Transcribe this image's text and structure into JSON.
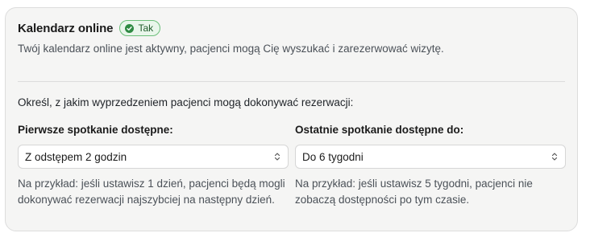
{
  "header": {
    "title": "Kalendarz online",
    "badge": "Tak",
    "description": "Twój kalendarz online jest aktywny, pacjenci mogą Cię wyszukać i zarezerwować wizytę."
  },
  "booking": {
    "intro": "Określ, z jakim wyprzedzeniem pacjenci mogą dokonywać rezerwacji:",
    "first": {
      "label": "Pierwsze spotkanie dostępne:",
      "value": "Z odstępem 2 godzin",
      "help": "Na przykład: jeśli ustawisz 1 dzień, pacjenci będą mogli dokonywać rezerwacji najszybciej na następny dzień."
    },
    "last": {
      "label": "Ostatnie spotkanie dostępne do:",
      "value": "Do 6 tygodni",
      "help": "Na przykład: jeśli ustawisz 5 tygodni, pacjenci nie zobaczą dostępności po tym czasie."
    }
  },
  "icons": {
    "badge_icon": "check-circle-icon",
    "select_icon": "chevron-up-down-icon"
  },
  "colors": {
    "badge_bg": "#e9f6eb",
    "badge_border": "#6cbf7a",
    "badge_icon": "#2f8a43",
    "card_bg": "#f5f5f4"
  }
}
